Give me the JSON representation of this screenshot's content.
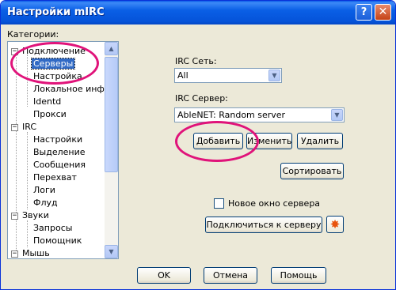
{
  "window": {
    "title": "Настройки mIRC",
    "help_glyph": "?",
    "close_glyph": "✕"
  },
  "categories": {
    "label": "Категории:",
    "items": [
      {
        "label": "Подключение",
        "expander": "−"
      },
      {
        "label": "Серверы",
        "selected": true
      },
      {
        "label": "Настройка"
      },
      {
        "label": "Локальное инфо"
      },
      {
        "label": "Identd"
      },
      {
        "label": "Прокси"
      },
      {
        "label": "IRC",
        "expander": "−"
      },
      {
        "label": "Настройки"
      },
      {
        "label": "Выделение"
      },
      {
        "label": "Сообщения"
      },
      {
        "label": "Перехват"
      },
      {
        "label": "Логи"
      },
      {
        "label": "Флуд"
      },
      {
        "label": "Звуки",
        "expander": "−"
      },
      {
        "label": "Запросы"
      },
      {
        "label": "Помощник"
      },
      {
        "label": "Мышь",
        "expander": "−"
      }
    ]
  },
  "network": {
    "label": "IRC Сеть:",
    "value": "All"
  },
  "server": {
    "label": "IRC Сервер:",
    "value": "AbleNET: Random server"
  },
  "buttons": {
    "add": "Добавить",
    "edit": "Изменить",
    "delete": "Удалить",
    "sort": "Сортировать",
    "connect": "Подключиться к серверу",
    "ok": "OK",
    "cancel": "Отмена",
    "help": "Помощь"
  },
  "new_window": {
    "label": "Новое окно сервера",
    "checked": false
  },
  "colors": {
    "title_bar": "#0a5fe6",
    "highlight_circle": "#e0137a",
    "selection": "#316ac5"
  }
}
